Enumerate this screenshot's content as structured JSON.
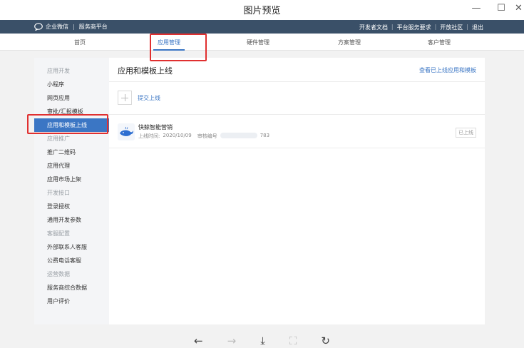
{
  "window": {
    "title": "图片预览",
    "controls": [
      "—",
      "☐",
      "✕"
    ]
  },
  "topbar": {
    "brand": "企业微信",
    "brand_sub": "服务商平台",
    "links": [
      "开发者文档",
      "平台服务要求",
      "开放社区",
      "退出"
    ]
  },
  "nav": {
    "items": [
      "首页",
      "应用管理",
      "硬件管理",
      "方案管理",
      "客户管理"
    ],
    "active_index": 1
  },
  "sidebar": {
    "groups": [
      {
        "title": "应用开发",
        "items": [
          "小程序",
          "网页应用",
          "审批/汇报模板",
          "应用和模板上线"
        ]
      },
      {
        "title": "应用推广",
        "items": [
          "推广二维码",
          "应用代理",
          "应用市场上架"
        ]
      },
      {
        "title": "开发接口",
        "items": [
          "登录授权",
          "通用开发参数"
        ]
      },
      {
        "title": "客服配置",
        "items": [
          "外部联系人客服",
          "公费电话客服"
        ]
      },
      {
        "title": "运营数据",
        "items": [
          "服务商综合数据",
          "用户评价"
        ]
      }
    ],
    "active_item": "应用和模板上线"
  },
  "main": {
    "title": "应用和模板上线",
    "head_link": "查看已上线应用和模板",
    "submit_label": "提交上线",
    "app": {
      "name": "快鲸智能营销",
      "online_time_label": "上线时间:",
      "online_time": "2020/10/09",
      "review_label": "审核编号",
      "review_suffix": "783",
      "status": "已上线"
    }
  },
  "viewer": {
    "tools": [
      "←",
      "→",
      "⤓",
      "⛶",
      "↻"
    ]
  },
  "colors": {
    "topbar": "#3a5068",
    "accent": "#3b76c4",
    "annotation": "#e03030"
  }
}
